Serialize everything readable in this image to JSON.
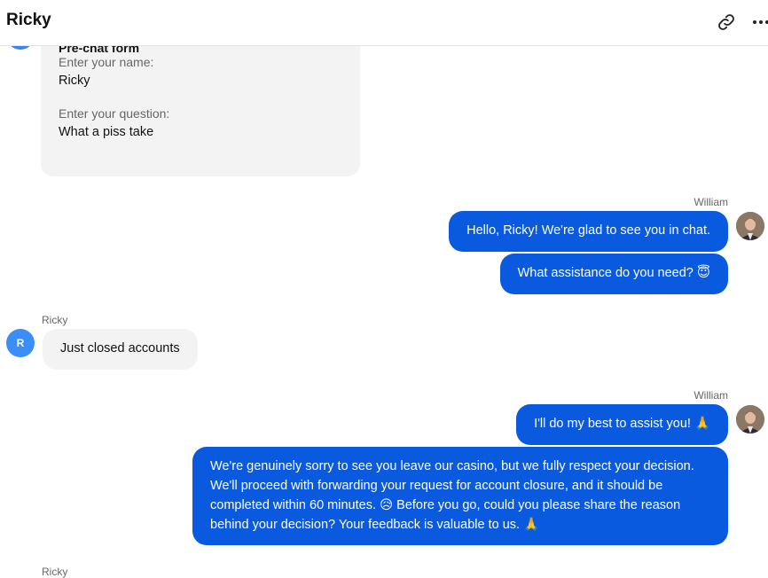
{
  "header": {
    "title": "Ricky",
    "link_icon": "link-icon",
    "more_icon": "more-horizontal-icon"
  },
  "colors": {
    "agent_bubble": "#0a5ae0",
    "visitor_bubble": "#f3f3f3",
    "visitor_avatar": "#3b8ef7"
  },
  "pre_chat_form": {
    "title": "Pre-chat form",
    "fields": [
      {
        "label": "Enter your name:",
        "value": "Ricky"
      },
      {
        "label": "Enter your question:",
        "value": "What a piss take"
      }
    ]
  },
  "messages": [
    {
      "sender": "William",
      "texts": [
        "Hello, Ricky! We're glad to see you in chat.",
        "What assistance do you need? 😇"
      ]
    },
    {
      "sender": "Ricky",
      "avatar_initial": "R",
      "texts": [
        "Just closed accounts"
      ]
    },
    {
      "sender": "William",
      "texts": [
        "I'll do my best to assist you! 🙏",
        "We're genuinely sorry to see you leave our casino, but we fully respect your decision. We'll proceed with forwarding your request for account closure, and it should be completed within 60 minutes. 😥 Before you go, could you please share the reason behind your decision? Your feedback is valuable to us. 🙏"
      ]
    },
    {
      "sender": "Ricky"
    }
  ]
}
